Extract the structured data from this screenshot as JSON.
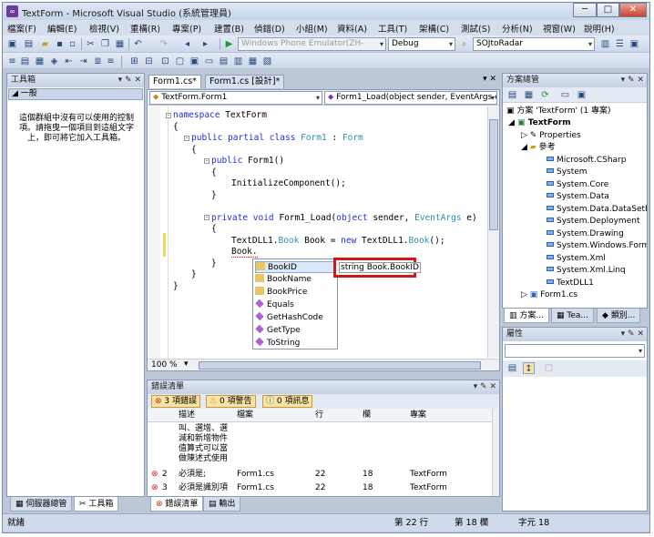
{
  "window": {
    "title": "TextForm - Microsoft Visual Studio (系統管理員)",
    "app_icon": "visual-studio-icon",
    "min": "─",
    "max": "□",
    "close": "✕"
  },
  "menu": [
    "檔案(F)",
    "編輯(E)",
    "檢視(V)",
    "重構(R)",
    "專案(P)",
    "建置(B)",
    "偵錯(D)",
    "小組(M)",
    "資料(A)",
    "工具(T)",
    "架構(C)",
    "測試(S)",
    "分析(N)",
    "視窗(W)",
    "說明(H)"
  ],
  "toolbar": {
    "platform": "Windows Phone Emulator(ZH-",
    "config": "Debug",
    "find": "SOJtoRadar"
  },
  "toolbox": {
    "title": "工具箱",
    "pin": "▾ ✎ ✕",
    "group": "一般",
    "empty_text": "這個群組中沒有可以使用的控制項。請拖曳一個項目到這組文字上，即可將它加入工具箱。",
    "tabs": [
      "伺服器總管",
      "工具箱"
    ]
  },
  "editor": {
    "tabs": [
      "Form1.cs*",
      "Form1.cs [設計]*"
    ],
    "type_dropdown": "TextForm.Form1",
    "member_dropdown": "Form1_Load(object sender, EventArgs e)",
    "zoom": "100 %",
    "lines": {
      "l1_kw": "namespace",
      "l1_rest": " TextForm",
      "l2": "{",
      "l3_kw": "public partial class",
      "l3_ty": " Form1",
      "l3_sep": " : ",
      "l3_base": "Form",
      "l4": "{",
      "l5_kw": "public",
      "l5_rest": " Form1()",
      "l6": "{",
      "l7": "InitializeComponent();",
      "l8": "}",
      "l9_kw": "private void",
      "l9_rest": " Form1_Load(",
      "l9_kw2": "object",
      "l9_rest2": " sender, ",
      "l9_ty": "EventArgs",
      "l9_rest3": " e)",
      "l10": "{",
      "l11_a": "TextDLL1.",
      "l11_ty": "Book",
      "l11_b": " Book = ",
      "l11_kw": "new",
      "l11_c": " TextDLL1.",
      "l11_ty2": "Book",
      "l11_d": "();",
      "l12": "Book.",
      "l13": "}",
      "l14": "}",
      "l15": "}"
    },
    "autocomplete": [
      "BookID",
      "BookName",
      "BookPrice",
      "Equals",
      "GetHashCode",
      "GetType",
      "ToString"
    ],
    "tooltip": "string Book.BookID"
  },
  "solution": {
    "title": "方案總管",
    "pin": "▾ ✎ ✕",
    "root": "方案 'TextForm' (1 專案)",
    "project": "TextForm",
    "properties": "Properties",
    "refs_label": "參考",
    "refs": [
      "Microsoft.CSharp",
      "System",
      "System.Core",
      "System.Data",
      "System.Data.DataSetExt",
      "System.Deployment",
      "System.Drawing",
      "System.Windows.Forms",
      "System.Xml",
      "System.Xml.Linq",
      "TextDLL1"
    ],
    "form": "Form1.cs",
    "tabs": [
      "方案...",
      "Tea...",
      "類別..."
    ]
  },
  "properties": {
    "title": "屬性",
    "pin": "▾ ✎ ✕"
  },
  "errors": {
    "title": "錯誤清單",
    "pin": "▾ ✎ ✕",
    "filters": [
      "3 項錯誤",
      "0 項警告",
      "0 項訊息"
    ],
    "headers": [
      "描述",
      "檔案",
      "行",
      "欄",
      "專案"
    ],
    "wrapped_desc": "叫、選增、選減和新增物件值算式可以當做陳述式使用",
    "rows": [
      {
        "num": "2",
        "desc": "必須是;",
        "file": "Form1.cs",
        "line": "22",
        "col": "18",
        "proj": "TextForm"
      },
      {
        "num": "3",
        "desc": "必須是識別項",
        "file": "Form1.cs",
        "line": "22",
        "col": "18",
        "proj": "TextForm"
      }
    ],
    "tabs": [
      "錯誤清單",
      "輸出"
    ]
  },
  "status": {
    "ready": "就緒",
    "line": "第 22 行",
    "col": "第 18 欄",
    "char": "字元 18"
  }
}
